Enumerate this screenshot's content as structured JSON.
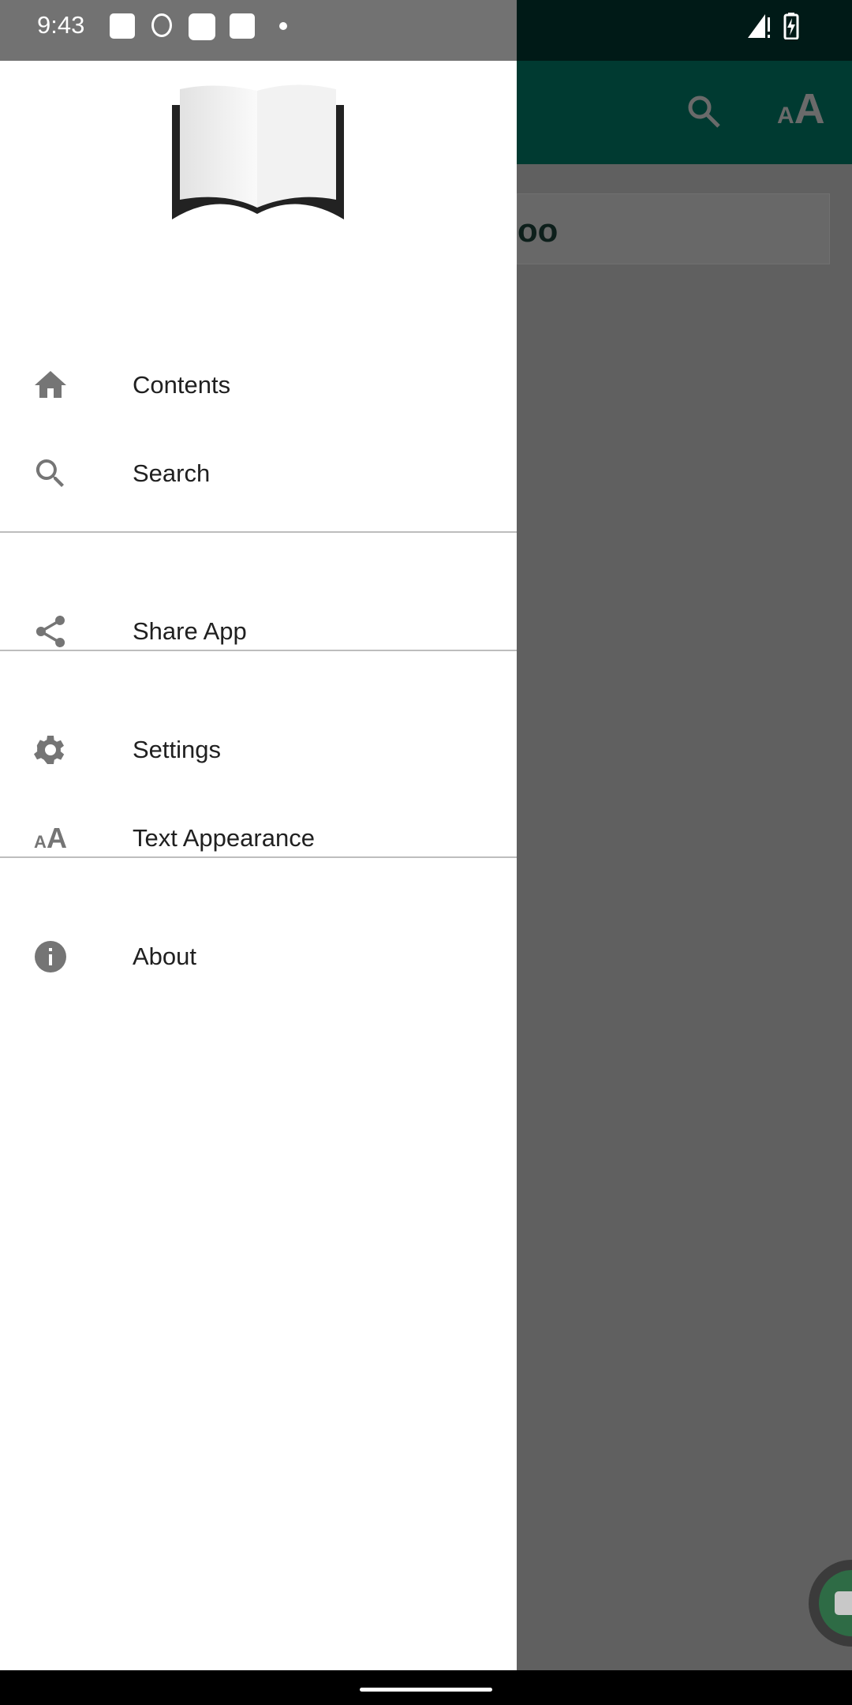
{
  "status_bar": {
    "time": "9:43"
  },
  "app_bar": {
    "icons": [
      "search-icon",
      "text-size-icon"
    ]
  },
  "content": {
    "card_text": "oo"
  },
  "drawer": {
    "items": [
      {
        "label": "Contents",
        "icon": "home-icon"
      },
      {
        "label": "Search",
        "icon": "search-icon"
      },
      {
        "label": "Share App",
        "icon": "share-icon"
      },
      {
        "label": "Settings",
        "icon": "gear-icon"
      },
      {
        "label": "Text Appearance",
        "icon": "text-size-icon"
      },
      {
        "label": "About",
        "icon": "info-icon"
      }
    ]
  },
  "colors": {
    "app_bar": "#003a31",
    "icon": "#757575",
    "fab": "#2e6b45"
  }
}
